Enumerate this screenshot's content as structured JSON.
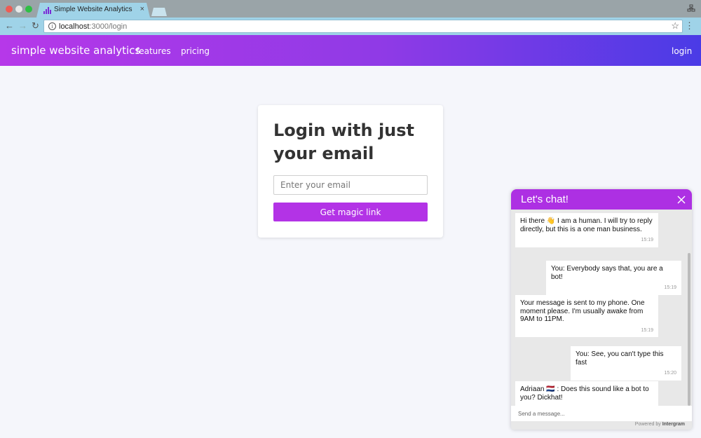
{
  "browser": {
    "tab_title": "Simple Website Analytics",
    "tab_close": "×",
    "url_host": "localhost",
    "url_path": ":3000/login",
    "back": "←",
    "forward": "→",
    "reload": "↻",
    "info": "i",
    "star": "☆",
    "menu": "⋮"
  },
  "site": {
    "brand": "simple website analytics",
    "nav": {
      "features": "features",
      "pricing": "pricing",
      "login": "login"
    }
  },
  "login": {
    "title": "Login with just your email",
    "email_placeholder": "Enter your email",
    "button": "Get magic link"
  },
  "chat": {
    "title": "Let's chat!",
    "messages": [
      {
        "text": "Hi there 👋 I am a human. I will try to reply directly, but this is a one man business.",
        "time": "15:19",
        "from": "agent"
      },
      {
        "text": "You: Everybody says that, you are a bot!",
        "time": "15:19",
        "from": "user"
      },
      {
        "text": "Your message is sent to my phone. One moment please. I'm usually awake from 9AM to 11PM.",
        "time": "15:19",
        "from": "agent"
      },
      {
        "text": "You: See, you can't type this fast",
        "time": "15:20",
        "from": "user"
      },
      {
        "text": "Adriaan 🇳🇱 : Does this sound like a bot to you? Dickhat!",
        "time": "",
        "from": "agent"
      }
    ],
    "input_placeholder": "Send a message...",
    "powered_prefix": "Powered by",
    "powered_brand": "Intergram"
  },
  "colors": {
    "accent": "#b333e6",
    "chat_header": "#ad30e3",
    "header_gradient_start": "#b638e9",
    "header_gradient_end": "#4a3be6"
  }
}
